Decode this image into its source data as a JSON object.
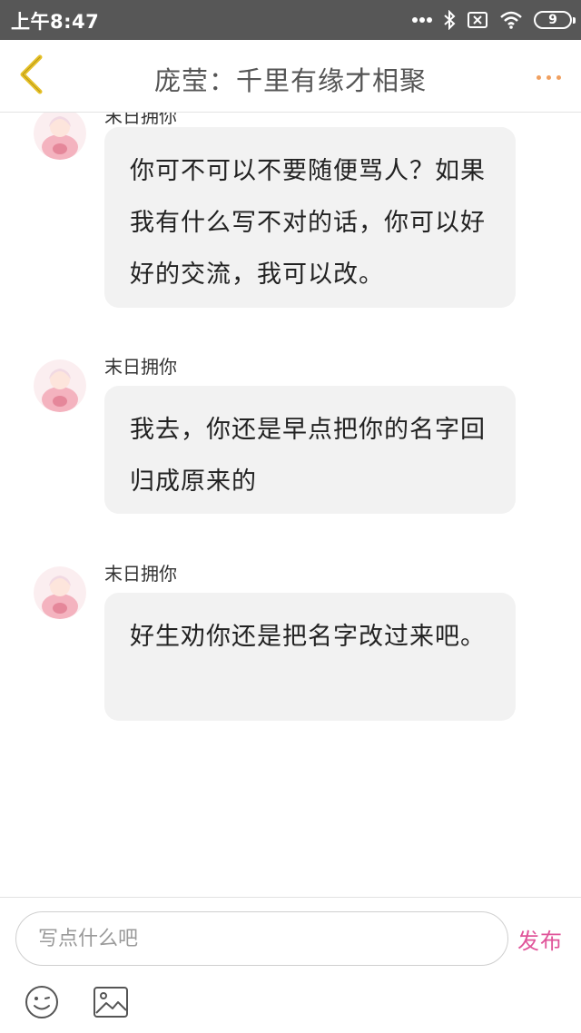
{
  "status_bar": {
    "time": "上午8:47",
    "battery": "9"
  },
  "nav": {
    "title": "庞莹：千里有缘才相聚"
  },
  "messages": [
    {
      "sender": "末日拥你",
      "text": "你可不可以不要随便骂人？如果我有什么写不对的话，你可以好好的交流，我可以改。"
    },
    {
      "sender": "末日拥你",
      "text": "我去，你还是早点把你的名字回归成原来的"
    },
    {
      "sender": "末日拥你",
      "text": "好生劝你还是把名字改过来吧。"
    }
  ],
  "composer": {
    "placeholder": "写点什么吧",
    "publish_label": "发布"
  },
  "icons": {
    "back": "chevron-left-icon",
    "more": "more-dots-icon",
    "emoji": "emoji-icon",
    "image": "image-icon"
  },
  "colors": {
    "status_bar_bg": "#575757",
    "back_icon": "#e6c12a",
    "more_dots": "#f0a060",
    "publish": "#e0559a",
    "bubble_bg": "#f2f2f2"
  }
}
